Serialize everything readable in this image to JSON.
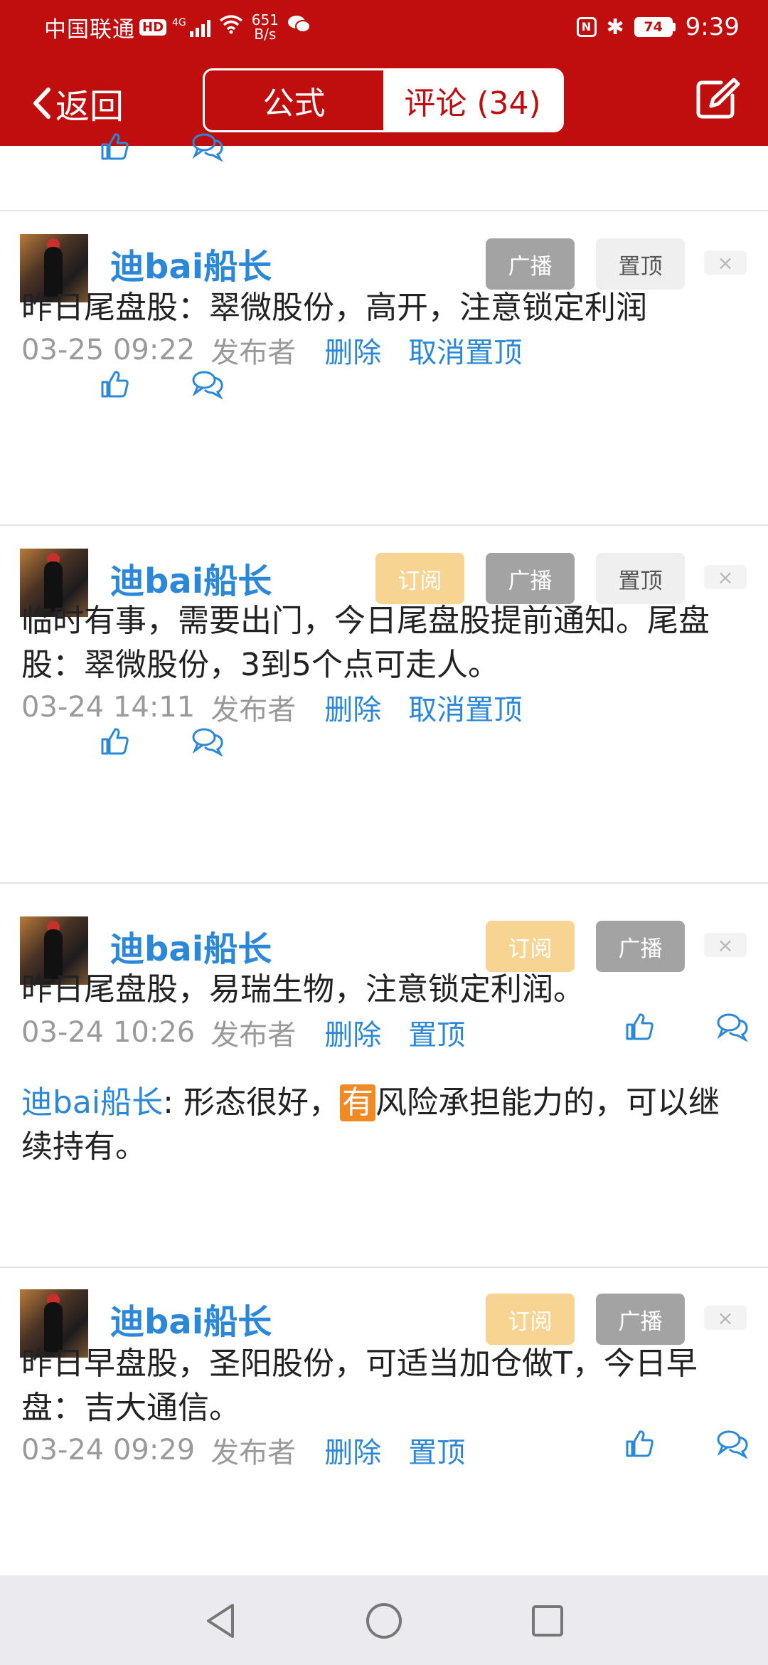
{
  "status_bar": {
    "carrier": "中国联通",
    "hd": "HD",
    "network": "4G",
    "speed_value": "651",
    "speed_unit": "B/s",
    "nfc": "N",
    "battery": "74",
    "time": "9:39"
  },
  "nav": {
    "back_label": "返回",
    "tab_formula": "公式",
    "tab_comments": "评论 (34)"
  },
  "posts": [
    {
      "username": "迪bai船长",
      "buttons": {
        "broadcast": "广播",
        "pin": "置顶",
        "close": "×"
      },
      "text": "昨日尾盘股：翠微股份，高开，注意锁定利润",
      "time": "03-25 09:22",
      "publisher": "发布者",
      "delete": "删除",
      "pin_action": "取消置顶"
    },
    {
      "username": "迪bai船长",
      "buttons": {
        "subscribe": "订阅",
        "broadcast": "广播",
        "pin": "置顶",
        "close": "×"
      },
      "text": "临时有事，需要出门，今日尾盘股提前通知。尾盘股：翠微股份，3到5个点可走人。",
      "time": "03-24 14:11",
      "publisher": "发布者",
      "delete": "删除",
      "pin_action": "取消置顶"
    },
    {
      "username": "迪bai船长",
      "buttons": {
        "subscribe": "订阅",
        "broadcast": "广播",
        "close": "×"
      },
      "text": "昨日尾盘股，易瑞生物，注意锁定利润。",
      "time": "03-24 10:26",
      "publisher": "发布者",
      "delete": "删除",
      "pin_action": "置顶",
      "reply": {
        "user": "迪bai船长",
        "sep": ":",
        "pre": " 形态很好，",
        "highlight": "有",
        "post": "风险承担能力的，可以继续持有。"
      }
    },
    {
      "username": "迪bai船长",
      "buttons": {
        "subscribe": "订阅",
        "broadcast": "广播",
        "close": "×"
      },
      "text": "昨日早盘股，圣阳股份，可适当加仓做T，今日早盘：吉大通信。",
      "time": "03-24 09:29",
      "publisher": "发布者",
      "delete": "删除",
      "pin_action": "置顶"
    }
  ],
  "colors": {
    "header": "#c00d0e",
    "link": "#2b88d8",
    "subscribe": "#f7d491",
    "broadcast": "#a3a3a3"
  }
}
